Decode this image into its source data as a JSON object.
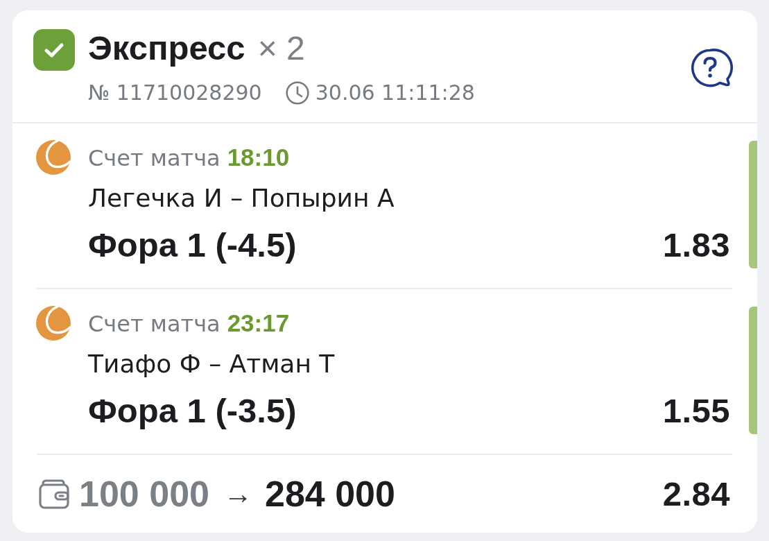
{
  "header": {
    "won": true,
    "title": "Экспресс",
    "multiplier": "× 2",
    "number": "№ 11710028290",
    "datetime": "30.06 11:11:28"
  },
  "events": [
    {
      "label": "Счет матча",
      "score": "18:10",
      "teams": "Легечка И – Попырин А",
      "market": "Фора 1 (-4.5)",
      "odds": "1.83",
      "won": true
    },
    {
      "label": "Счет матча",
      "score": "23:17",
      "teams": "Тиафо Ф – Атман Т",
      "market": "Фора 1 (-3.5)",
      "odds": "1.55",
      "won": true
    }
  ],
  "footer": {
    "stake": "100 000",
    "arrow": "→",
    "payout": "284 000",
    "total_odds": "2.84"
  }
}
